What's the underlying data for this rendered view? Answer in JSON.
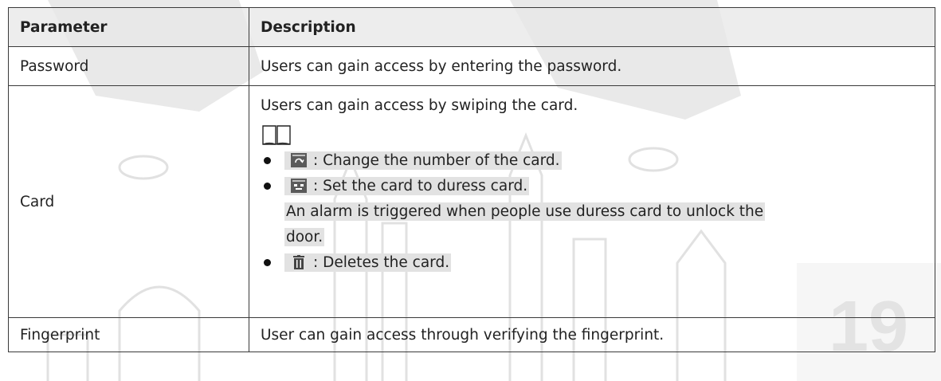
{
  "table": {
    "headers": {
      "parameter": "Parameter",
      "description": "Description"
    },
    "rows": {
      "password": {
        "parameter": "Password",
        "description": "Users can gain access by entering the password."
      },
      "card": {
        "parameter": "Card",
        "intro": "Users can gain access by swiping the card.",
        "note_icon": "book-icon",
        "options": [
          {
            "icon": "card-refresh-icon",
            "text": ": Change the number of the card."
          },
          {
            "icon": "duress-card-icon",
            "text": ": Set the card to duress card.",
            "extra_line1": "An alarm is triggered when people use duress card to unlock the",
            "extra_line2": "door."
          },
          {
            "icon": "trash-icon",
            "text": ": Deletes the card."
          }
        ]
      },
      "fingerprint": {
        "parameter": "Fingerprint",
        "description": "User can gain access through verifying the fingerprint."
      }
    }
  },
  "colors": {
    "border": "#3a3a3a",
    "header_bg": "#e8e8e8",
    "highlight": "#e2e2e2",
    "watermark": "#d9d9d9"
  }
}
